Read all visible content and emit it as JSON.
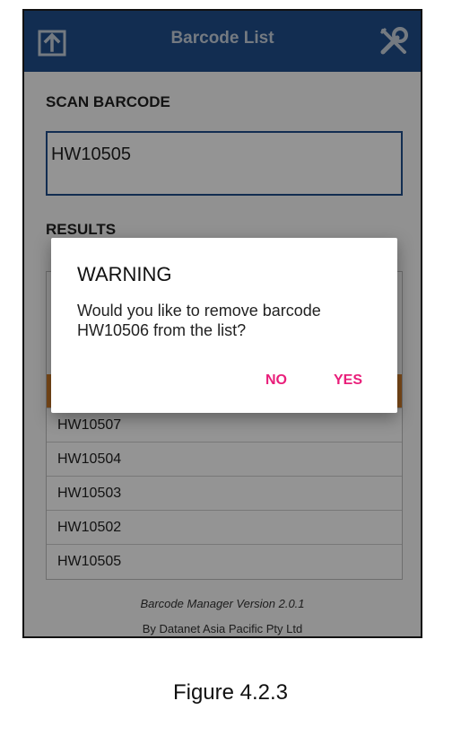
{
  "app": {
    "title": "Barcode List",
    "upload_icon": "upload-icon",
    "settings_icon": "wrench-icon",
    "accent": "#1f4e8c",
    "highlight": "#d9822b",
    "button_color": "#e91e7a"
  },
  "scan": {
    "label": "SCAN BARCODE",
    "value": "HW10505"
  },
  "results": {
    "label": "RESULTS",
    "items": [
      "HW10507",
      "HW10504",
      "HW10503",
      "HW10502",
      "HW10505"
    ]
  },
  "footer": {
    "version": "Barcode Manager Version 2.0.1",
    "company": "By Datanet Asia Pacific Pty Ltd"
  },
  "dialog": {
    "title": "WARNING",
    "message": "Would you like to remove barcode HW10506 from the list?",
    "no_label": "NO",
    "yes_label": "YES"
  },
  "caption": "Figure 4.2.3"
}
